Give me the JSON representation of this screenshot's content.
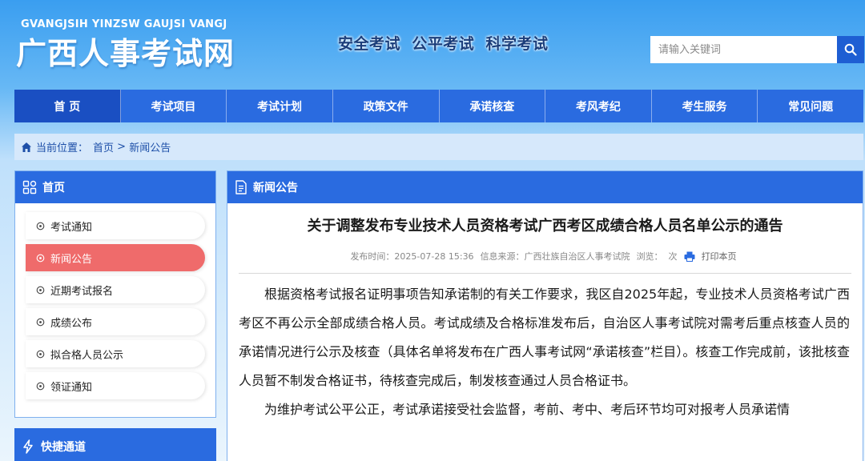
{
  "site": {
    "logo_en": "GVANGJSIH YINZSW GAUJSI VANGJ",
    "logo_cn": "广西人事考试网",
    "slogan": "安全考试  公平考试  科学考试"
  },
  "search": {
    "placeholder": "请输入关键词"
  },
  "nav": {
    "items": [
      "首 页",
      "考试项目",
      "考试计划",
      "政策文件",
      "承诺核查",
      "考风考纪",
      "考生服务",
      "常见问题"
    ],
    "active_index": 0
  },
  "breadcrumb": {
    "prefix": "当前位置：",
    "home": "首页",
    "separator": " > ",
    "current": "新闻公告"
  },
  "sidebar": {
    "title": "首页",
    "items": [
      "考试通知",
      "新闻公告",
      "近期考试报名",
      "成绩公布",
      "拟合格人员公示",
      "领证通知"
    ],
    "active_index": 1,
    "quick_title": "快捷通道"
  },
  "content": {
    "section_title": "新闻公告",
    "article_title": "关于调整发布专业技术人员资格考试广西考区成绩合格人员名单公示的通告",
    "meta": {
      "publish_time": "发布时间：2025-07-28 15:36",
      "source": "信息来源：广西壮族自治区人事考试院",
      "views": "浏览：  次",
      "print": "打印本页"
    },
    "paragraphs": [
      "根据资格考试报名证明事项告知承诺制的有关工作要求，我区自2025年起，专业技术人员资格考试广西考区不再公示全部成绩合格人员。考试成绩及合格标准发布后，自治区人事考试院对需考后重点核查人员的承诺情况进行公示及核查（具体名单将发布在广西人事考试网“承诺核查”栏目）。核查工作完成前，该批核查人员暂不制发合格证书，待核查完成后，制发核查通过人员合格证书。",
      "为维护考试公平公正，考试承诺接受社会监督，考前、考中、考后环节均可对报考人员承诺情"
    ]
  },
  "colors": {
    "nav_blue": "#2a6be0",
    "nav_active": "#1a4fc2",
    "sidebar_active": "#ef6b6b",
    "breadcrumb_bg": "#d6e8fb"
  }
}
